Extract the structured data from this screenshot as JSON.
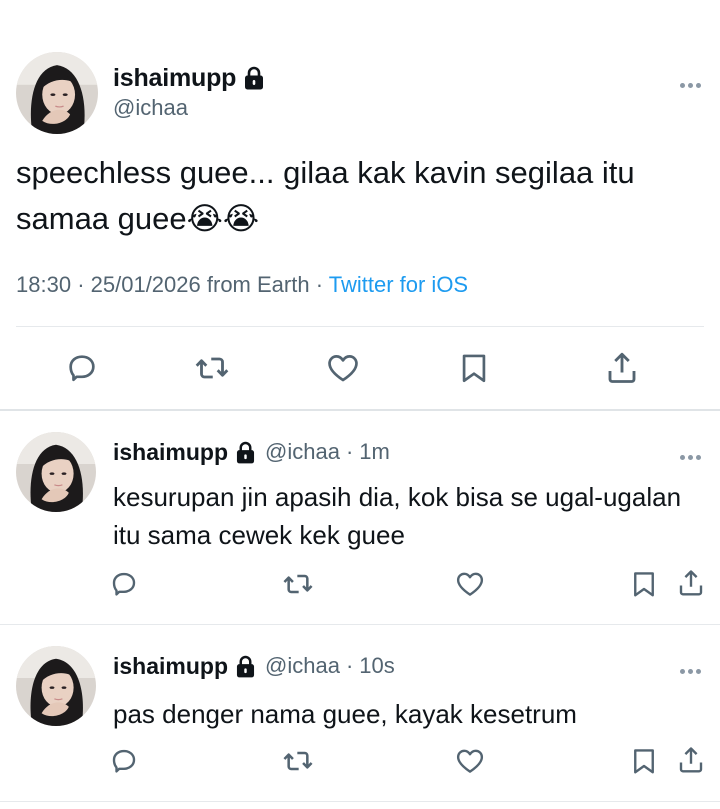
{
  "main_tweet": {
    "name": "ishaimupp",
    "handle": "@ichaa",
    "text": "speechless guee... gilaa kak kavin segilaa itu samaa guee😭😭",
    "time": "18:30",
    "date": "25/01/2026",
    "location": "from Earth",
    "source": "Twitter for iOS",
    "separator": "·"
  },
  "replies": [
    {
      "name": "ishaimupp",
      "handle": "@ichaa",
      "time": "1m",
      "text": "kesurupan jin apasih dia, kok bisa se ugal-ugalan itu sama cewek kek guee"
    },
    {
      "name": "ishaimupp",
      "handle": "@ichaa",
      "time": "10s",
      "text": "pas denger nama guee, kayak kesetrum"
    }
  ],
  "icons": {
    "reply": "reply-icon",
    "retweet": "retweet-icon",
    "like": "heart-icon",
    "bookmark": "bookmark-icon",
    "share": "share-icon",
    "more": "more-icon",
    "lock": "lock-icon"
  },
  "colors": {
    "text": "#0f1419",
    "secondary": "#536471",
    "accent": "#1d9bf0",
    "divider": "#e6e9ec"
  }
}
